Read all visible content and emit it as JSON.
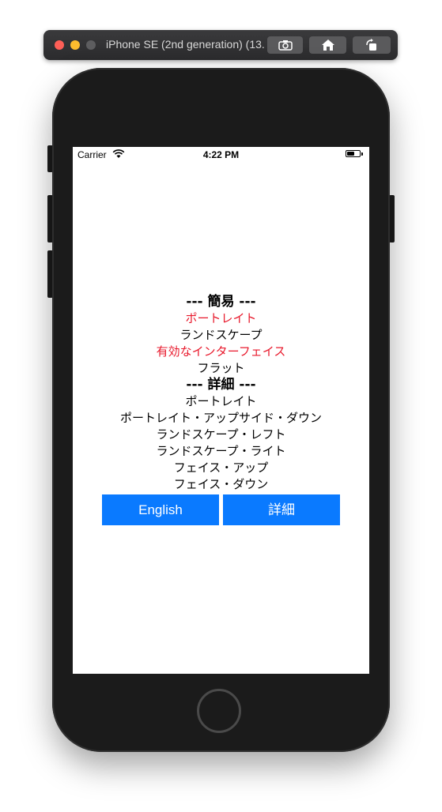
{
  "simulator": {
    "title": "iPhone SE (2nd generation) (13..."
  },
  "status_bar": {
    "carrier": "Carrier",
    "time": "4:22 PM"
  },
  "orientation_list": {
    "simple_header": "--- 簡易 ---",
    "simple_items": [
      {
        "label": "ポートレイト",
        "color": "#e8192c"
      },
      {
        "label": "ランドスケープ",
        "color": "#000000"
      },
      {
        "label": "有効なインターフェイス",
        "color": "#e8192c"
      },
      {
        "label": "フラット",
        "color": "#000000"
      }
    ],
    "detail_header": "--- 詳細 ---",
    "detail_items": [
      "ポートレイト",
      "ポートレイト・アップサイド・ダウン",
      "ランドスケープ・レフト",
      "ランドスケープ・ライト",
      "フェイス・アップ",
      "フェイス・ダウン"
    ]
  },
  "buttons": {
    "english_label": "English",
    "detail_label": "詳細"
  },
  "colors": {
    "accent": "#0a7aff",
    "highlight": "#e8192c"
  }
}
